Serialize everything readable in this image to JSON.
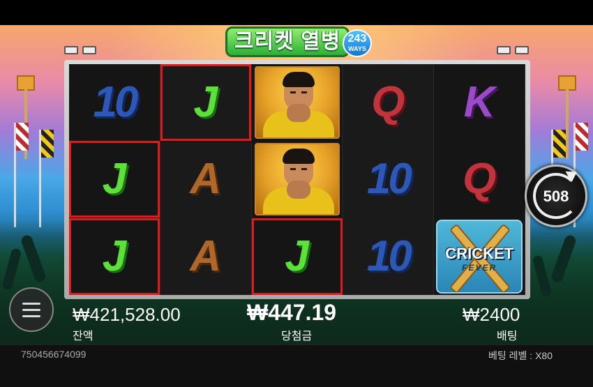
{
  "game": {
    "logo_title": "크리켓 열병",
    "logo_ways_number": "243",
    "logo_ways_label": "WAYS"
  },
  "reels": [
    [
      "10",
      "J",
      "J"
    ],
    [
      "J",
      "A",
      "A"
    ],
    [
      "player",
      "player",
      "J"
    ],
    [
      "Q",
      "10",
      "10"
    ],
    [
      "K",
      "Q",
      "scatter"
    ]
  ],
  "winning_cells": [
    [
      0,
      1
    ],
    [
      0,
      2
    ],
    [
      1,
      0
    ],
    [
      2,
      2
    ]
  ],
  "scatter": {
    "title": "CRICKET",
    "subtitle": "FEVER"
  },
  "spin": {
    "auto_count": "508"
  },
  "stats": {
    "balance_value": "₩421,528.00",
    "balance_label": "잔액",
    "win_value": "₩447.19",
    "win_label": "당첨금",
    "bet_value": "₩2400",
    "bet_label": "배팅"
  },
  "footer": {
    "round_id": "750456674099",
    "bet_level": "베팅 레벨 : X80"
  },
  "colors": {
    "win_highlight": "#e01a1a",
    "symbol_10": "#2d58b8",
    "symbol_J": "#5ee03a",
    "symbol_A": "#b0682a",
    "symbol_Q": "#c0343c",
    "symbol_K": "#9a4bc8"
  }
}
